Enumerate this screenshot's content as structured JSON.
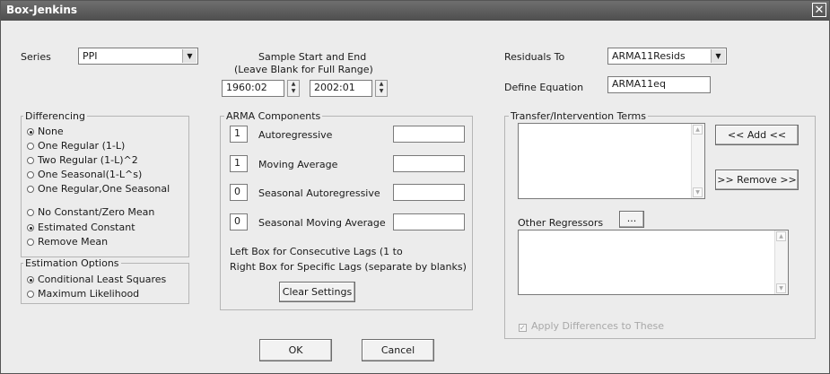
{
  "window": {
    "title": "Box-Jenkins",
    "close_glyph": "✕"
  },
  "series": {
    "label": "Series",
    "value": "PPI"
  },
  "sample": {
    "line1": "Sample Start and End",
    "line2": "(Leave Blank for Full Range)",
    "start": "1960:02",
    "end": "2002:01"
  },
  "residuals": {
    "label": "Residuals To",
    "value": "ARMA11Resids"
  },
  "define_equation": {
    "label": "Define Equation",
    "value": "ARMA11eq"
  },
  "differencing": {
    "title": "Differencing",
    "options": [
      {
        "label": "None",
        "checked": true
      },
      {
        "label": "One Regular (1-L)",
        "checked": false
      },
      {
        "label": "Two Regular (1-L)^2",
        "checked": false
      },
      {
        "label": "One Seasonal(1-L^s)",
        "checked": false
      },
      {
        "label": "One Regular,One Seasonal",
        "checked": false
      }
    ],
    "mean_options": [
      {
        "label": "No Constant/Zero Mean",
        "checked": false
      },
      {
        "label": "Estimated Constant",
        "checked": true
      },
      {
        "label": "Remove Mean",
        "checked": false
      }
    ]
  },
  "estimation": {
    "title": "Estimation Options",
    "options": [
      {
        "label": "Conditional Least Squares",
        "checked": true
      },
      {
        "label": "Maximum Likelihood",
        "checked": false
      }
    ]
  },
  "arma": {
    "title": "ARMA Components",
    "rows": [
      {
        "count": "1",
        "label": "Autoregressive",
        "specific": ""
      },
      {
        "count": "1",
        "label": "Moving Average",
        "specific": ""
      },
      {
        "count": "0",
        "label": "Seasonal Autoregressive",
        "specific": ""
      },
      {
        "count": "0",
        "label": "Seasonal Moving Average",
        "specific": ""
      }
    ],
    "note1": "Left Box for Consecutive Lags (1 to",
    "note2": "Right Box for Specific Lags (separate by blanks)",
    "clear_label": "Clear Settings"
  },
  "transfer": {
    "title": "Transfer/Intervention Terms",
    "add_label": "<< Add <<",
    "remove_label": ">> Remove >>",
    "other_label": "Other Regressors",
    "other_button": "...",
    "apply_label": "Apply Differences to These",
    "apply_checked": true
  },
  "footer": {
    "ok_label": "OK",
    "cancel_label": "Cancel"
  },
  "icons": {
    "dropdown": "arrow-down-icon",
    "spin": "spin-arrows-icon",
    "close": "close-icon"
  }
}
